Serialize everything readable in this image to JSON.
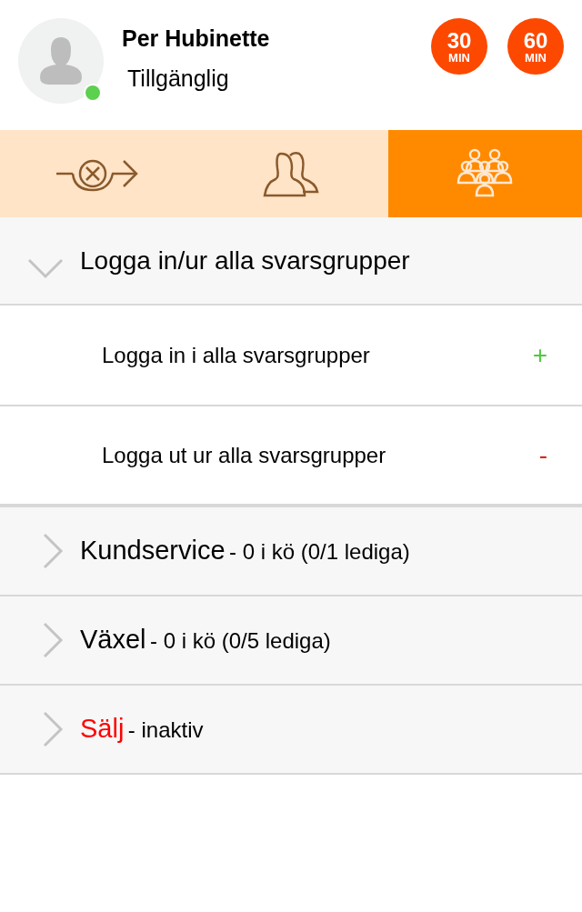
{
  "user": {
    "name": "Per Hubinette",
    "status": "Tillgänglig",
    "online": true
  },
  "timer_buttons": [
    {
      "number": "30",
      "unit": "MIN"
    },
    {
      "number": "60",
      "unit": "MIN"
    }
  ],
  "tabs": [
    {
      "kind": "redirect",
      "selected": false
    },
    {
      "kind": "contacts",
      "selected": false
    },
    {
      "kind": "groups",
      "selected": true
    }
  ],
  "section": {
    "title": "Logga in/ur alla svarsgrupper",
    "expanded": true,
    "actions": [
      {
        "label": "Logga in i alla svarsgrupper",
        "symbol": "+",
        "kind": "add"
      },
      {
        "label": "Logga ut ur alla svarsgrupper",
        "symbol": "-",
        "kind": "remove"
      }
    ]
  },
  "groups": [
    {
      "name": "Kundservice",
      "detail": "- 0 i kö (0/1 lediga)",
      "active": true,
      "expanded": false
    },
    {
      "name": "Växel",
      "detail": "- 0 i kö (0/5 lediga)",
      "active": true,
      "expanded": false
    },
    {
      "name": "Sälj",
      "detail": "- inaktiv",
      "active": false,
      "expanded": false
    }
  ]
}
